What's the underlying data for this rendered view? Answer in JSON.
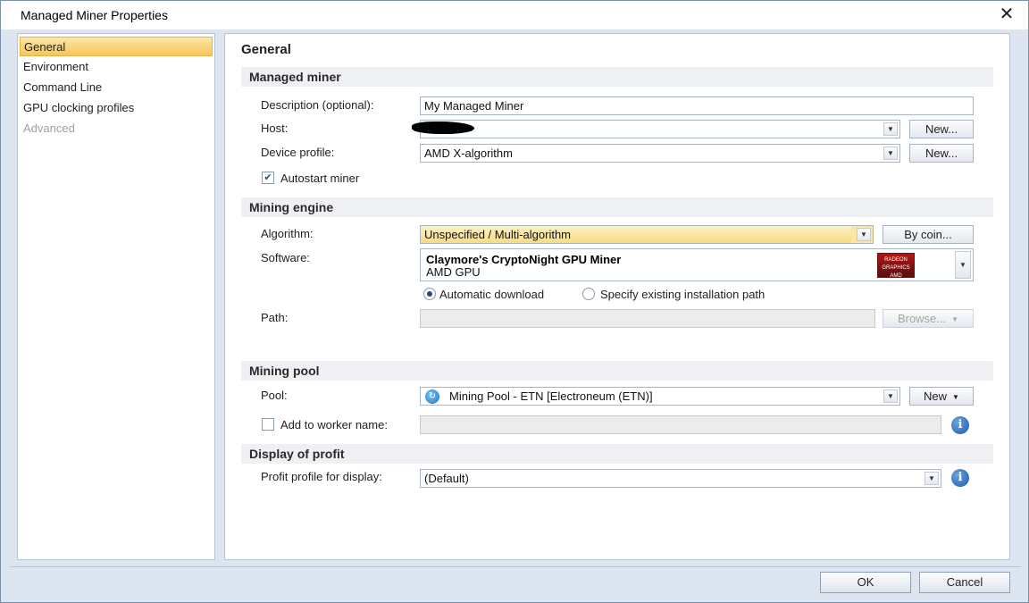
{
  "window": {
    "title": "Managed Miner Properties",
    "close_glyph": "✕"
  },
  "nav": {
    "items": [
      {
        "label": "General",
        "selected": true
      },
      {
        "label": "Environment"
      },
      {
        "label": "Command Line"
      },
      {
        "label": "GPU clocking profiles"
      },
      {
        "label": "Advanced",
        "disabled": true
      }
    ]
  },
  "panel": {
    "title": "General"
  },
  "managed_miner": {
    "header": "Managed miner",
    "description_label": "Description (optional):",
    "description_value": "My Managed Miner",
    "host_label": "Host:",
    "host_value": "",
    "host_new_button": "New...",
    "device_profile_label": "Device profile:",
    "device_profile_value": "AMD X-algorithm",
    "device_profile_new_button": "New...",
    "autostart_label": "Autostart miner",
    "autostart_checked": true
  },
  "mining_engine": {
    "header": "Mining engine",
    "algorithm_label": "Algorithm:",
    "algorithm_value": "Unspecified / Multi-algorithm",
    "by_coin_button": "By coin...",
    "software_label": "Software:",
    "software_name": "Claymore's CryptoNight GPU Miner",
    "software_sub": "AMD GPU",
    "logo_text": "RADEON GRAPHICS AMD",
    "automatic_download_label": "Automatic download",
    "specify_path_label": "Specify existing installation path",
    "path_label": "Path:",
    "path_value": "",
    "browse_button": "Browse..."
  },
  "mining_pool": {
    "header": "Mining pool",
    "pool_label": "Pool:",
    "pool_value": "Mining Pool - ETN [Electroneum (ETN)]",
    "new_button": "New",
    "add_worker_label": "Add to worker name:",
    "add_worker_checked": false,
    "worker_value": ""
  },
  "display_profit": {
    "header": "Display of profit",
    "profit_label": "Profit profile for display:",
    "profit_value": "(Default)"
  },
  "footer": {
    "ok_button": "OK",
    "cancel_button": "Cancel"
  },
  "icons": {
    "arrow": "▼",
    "check": "✔",
    "info": "i",
    "pool": "↻"
  }
}
